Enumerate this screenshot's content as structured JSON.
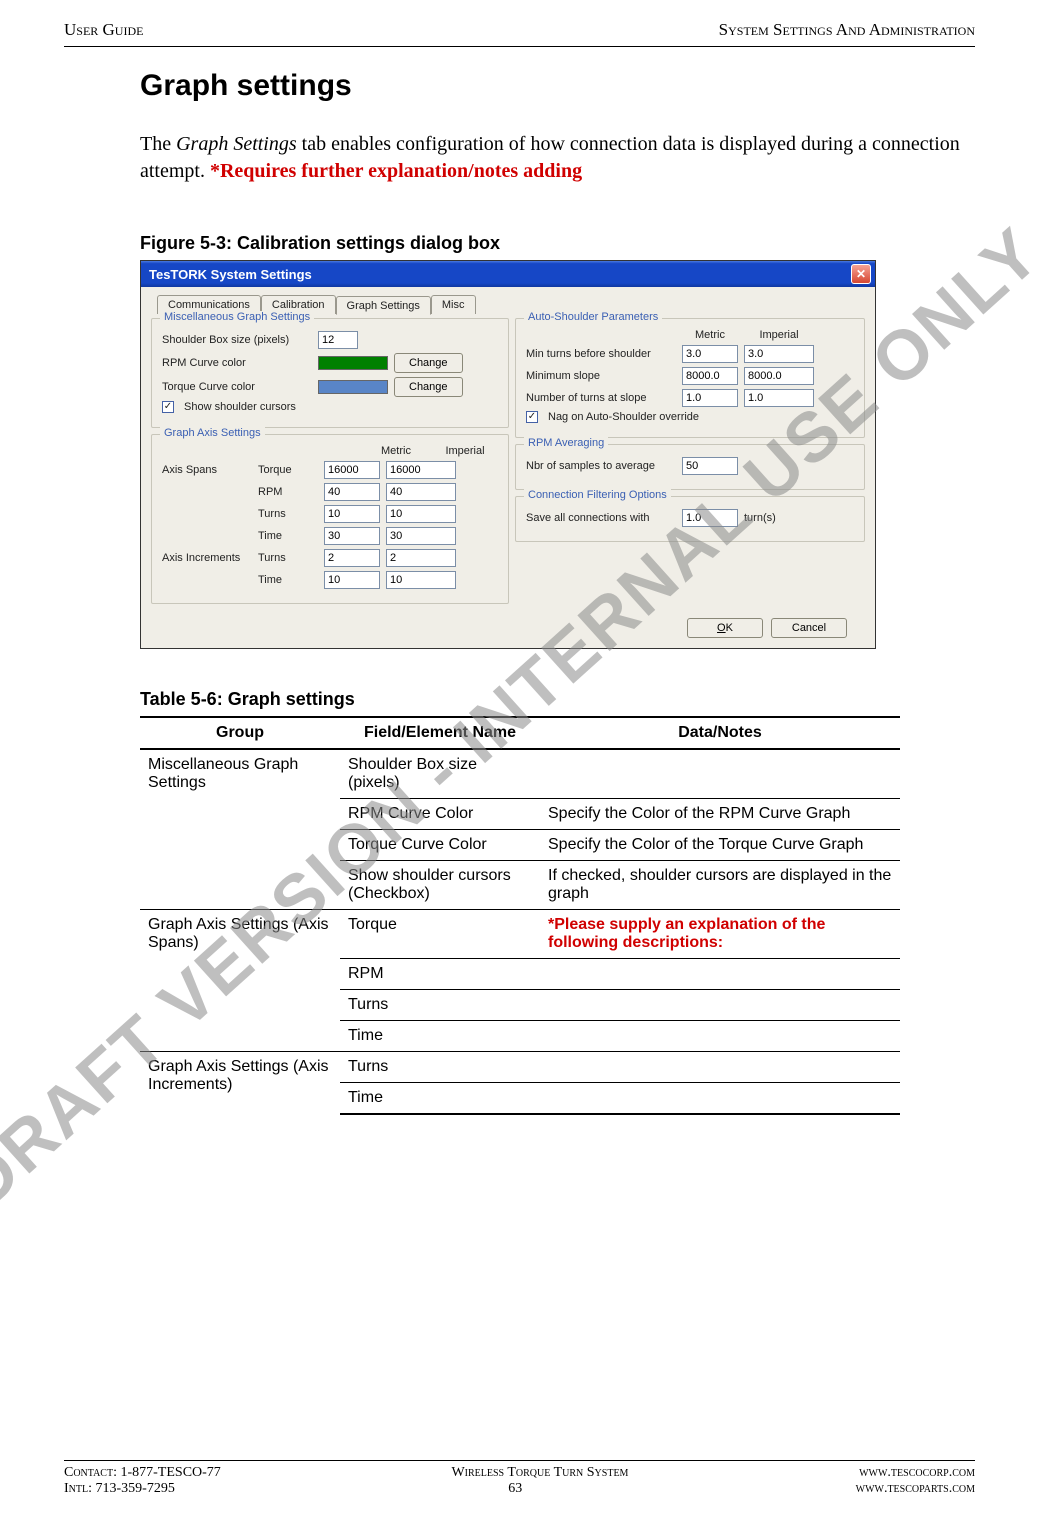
{
  "header": {
    "left": "User Guide",
    "right": "System Settings And Administration"
  },
  "sectionTitle": "Graph settings",
  "intro": {
    "lead": "The ",
    "em": "Graph Settings",
    "rest": " tab enables configuration of how connection data is displayed during a connection attempt. ",
    "note": "*Requires further explanation/notes adding"
  },
  "figureCaption": "Figure 5-3: Calibration settings dialog box",
  "dialog": {
    "title": "TesTORK System Settings",
    "tabs": [
      "Communications",
      "Calibration",
      "Graph Settings",
      "Misc"
    ],
    "activeTab": 2,
    "misc": {
      "legend": "Miscellaneous Graph Settings",
      "shoulderBoxLabel": "Shoulder Box size (pixels)",
      "shoulderBoxValue": "12",
      "rpmColorLabel": "RPM Curve color",
      "torqueColorLabel": "Torque Curve color",
      "rpmColor": "#008000",
      "torqueColor": "#5985c7",
      "changeLabel": "Change",
      "showShoulderLabel": "Show shoulder cursors",
      "showShoulderChecked": true
    },
    "axis": {
      "legend": "Graph Axis Settings",
      "colMetric": "Metric",
      "colImperial": "Imperial",
      "spansLabel": "Axis Spans",
      "incLabel": "Axis Increments",
      "rows": [
        {
          "label": "Torque",
          "metric": "16000",
          "imperial": "16000"
        },
        {
          "label": "RPM",
          "metric": "40",
          "imperial": "40"
        },
        {
          "label": "Turns",
          "metric": "10",
          "imperial": "10"
        },
        {
          "label": "Time",
          "metric": "30",
          "imperial": "30"
        }
      ],
      "incRows": [
        {
          "label": "Turns",
          "metric": "2",
          "imperial": "2"
        },
        {
          "label": "Time",
          "metric": "10",
          "imperial": "10"
        }
      ]
    },
    "auto": {
      "legend": "Auto-Shoulder Parameters",
      "colMetric": "Metric",
      "colImperial": "Imperial",
      "rows": [
        {
          "label": "Min turns before shoulder",
          "metric": "3.0",
          "imperial": "3.0"
        },
        {
          "label": "Minimum slope",
          "metric": "8000.0",
          "imperial": "8000.0"
        },
        {
          "label": "Number of turns at slope",
          "metric": "1.0",
          "imperial": "1.0"
        }
      ],
      "nagLabel": "Nag on Auto-Shoulder override",
      "nagChecked": true
    },
    "rpmAvg": {
      "legend": "RPM Averaging",
      "label": "Nbr of samples to average",
      "value": "50"
    },
    "conn": {
      "legend": "Connection Filtering Options",
      "label": "Save all connections with",
      "value": "1.0",
      "unit": "turn(s)"
    },
    "okLabel": "OK",
    "cancelLabel": "Cancel"
  },
  "tableCaption": "Table 5-6: Graph settings",
  "table": {
    "headers": [
      "Group",
      "Field/Element Name",
      "Data/Notes"
    ],
    "rows": [
      {
        "group": "Miscellaneous Graph Settings",
        "groupSpan": 4,
        "field": "Shoulder Box size (pixels)",
        "notes": ""
      },
      {
        "field": "RPM Curve Color",
        "notes": "Specify the Color of the RPM Curve Graph"
      },
      {
        "field": "Torque Curve Color",
        "notes": "Specify the Color of the Torque Curve Graph"
      },
      {
        "field": "Show shoulder cursors (Checkbox)",
        "notes": "If checked, shoulder cursors are displayed in the graph"
      },
      {
        "group": "Graph Axis Settings (Axis Spans)",
        "groupSpan": 4,
        "field": "Torque",
        "notes": "*Please supply an explanation of the following descriptions:",
        "notesRed": true
      },
      {
        "field": "RPM",
        "notes": ""
      },
      {
        "field": "Turns",
        "notes": ""
      },
      {
        "field": "Time",
        "notes": ""
      },
      {
        "group": "Graph Axis Settings (Axis Increments)",
        "groupSpan": 2,
        "field": "Turns",
        "notes": ""
      },
      {
        "field": "Time",
        "notes": "",
        "last": true
      }
    ]
  },
  "footer": {
    "contact": "Contact: 1-877-TESCO-77",
    "intl": "Intl: 713-359-7295",
    "systemName": "Wireless Torque Turn System",
    "pageNum": "63",
    "url1": "www.tescocorp.com",
    "url2": "www.tescoparts.com"
  },
  "watermark": "DRAFT VERSION - INTERNAL USE ONLY"
}
